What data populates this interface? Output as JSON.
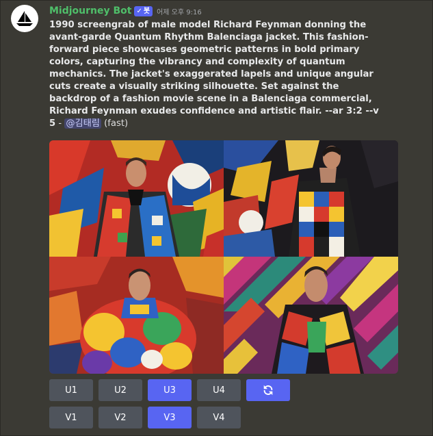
{
  "author": {
    "name": "Midjourney Bot",
    "badge_check": "✓",
    "badge_label": "봇",
    "timestamp": "어제 오후 9:16",
    "name_color": "#4fbf6a",
    "badge_color": "#5865f2"
  },
  "message": {
    "prompt": "1990 screengrab of male model Richard Feynman donning the avant-garde Quantum Rhythm Balenciaga jacket. This fashion-forward piece showcases geometric patterns in bold primary colors, capturing the vibrancy and complexity of quantum mechanics. The jacket's exaggerated lapels and unique angular cuts create a visually striking silhouette. Set against the backdrop of a fashion movie scene in a Balenciaga commercial, Richard Feynman exudes confidence and artistic flair. --ar 3:2 --v 5",
    "separator": " - ",
    "mention": "@김태림",
    "speed": " (fast)"
  },
  "image_grid": {
    "icon": "generated-image-grid"
  },
  "buttons": {
    "upscale": [
      {
        "label": "U1",
        "selected": false
      },
      {
        "label": "U2",
        "selected": false
      },
      {
        "label": "U3",
        "selected": true
      },
      {
        "label": "U4",
        "selected": false
      }
    ],
    "reroll_icon": "refresh-icon",
    "variation": [
      {
        "label": "V1",
        "selected": false
      },
      {
        "label": "V2",
        "selected": false
      },
      {
        "label": "V3",
        "selected": true
      },
      {
        "label": "V4",
        "selected": false
      }
    ]
  },
  "colors": {
    "background": "#3b3a34",
    "button": "#4f545c",
    "button_selected": "#5865f2"
  }
}
